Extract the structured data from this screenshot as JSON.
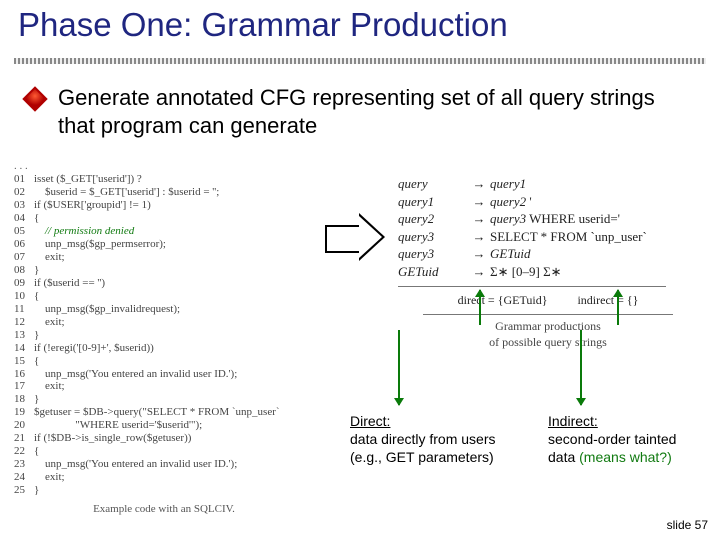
{
  "title": "Phase One: Grammar Production",
  "bullet": "Generate annotated CFG representing set of all query strings that program can generate",
  "code": {
    "ellipsis": ". . .",
    "lines": [
      {
        "n": "01",
        "t": "isset ($_GET['userid']) ?"
      },
      {
        "n": "02",
        "t": "    $userid = $_GET['userid'] : $userid = '';"
      },
      {
        "n": "03",
        "t": "if ($USER['groupid'] != 1)"
      },
      {
        "n": "04",
        "t": "{"
      },
      {
        "n": "05",
        "t": "    // permission denied",
        "comment": true
      },
      {
        "n": "06",
        "t": "    unp_msg($gp_permserror);"
      },
      {
        "n": "07",
        "t": "    exit;"
      },
      {
        "n": "08",
        "t": "}"
      },
      {
        "n": "09",
        "t": "if ($userid == '')"
      },
      {
        "n": "10",
        "t": "{"
      },
      {
        "n": "11",
        "t": "    unp_msg($gp_invalidrequest);"
      },
      {
        "n": "12",
        "t": "    exit;"
      },
      {
        "n": "13",
        "t": "}"
      },
      {
        "n": "14",
        "t": "if (!eregi('[0-9]+', $userid))"
      },
      {
        "n": "15",
        "t": "{"
      },
      {
        "n": "16",
        "t": "    unp_msg('You entered an invalid user ID.');"
      },
      {
        "n": "17",
        "t": "    exit;"
      },
      {
        "n": "18",
        "t": "}"
      },
      {
        "n": "19",
        "t": "$getuser = $DB->query(\"SELECT * FROM `unp_user`"
      },
      {
        "n": "20",
        "t": "               \"WHERE userid='$userid'\");"
      },
      {
        "n": "21",
        "t": "if (!$DB->is_single_row($getuser))"
      },
      {
        "n": "22",
        "t": "{"
      },
      {
        "n": "23",
        "t": "    unp_msg('You entered an invalid user ID.');"
      },
      {
        "n": "24",
        "t": "    exit;"
      },
      {
        "n": "25",
        "t": "}"
      }
    ],
    "caption": "Example code with an SQLCIV."
  },
  "grammar": {
    "productions": [
      {
        "lhs": "query",
        "rhs_italic_a": "query1",
        "rhs_rest": ""
      },
      {
        "lhs": "query1",
        "rhs_italic_a": "query2",
        "rhs_rest": "'"
      },
      {
        "lhs": "query2",
        "rhs_italic_a": "query3",
        "rhs_rest": " WHERE userid='"
      },
      {
        "lhs": "query3",
        "rhs_italic_a": "",
        "rhs_rest": "SELECT * FROM `unp_user`"
      },
      {
        "lhs": "query3",
        "rhs_italic_a": "GETuid",
        "rhs_rest": ""
      },
      {
        "lhs": "GETuid",
        "rhs_italic_a": "",
        "rhs_rest": "Σ∗ [0–9] Σ∗"
      }
    ],
    "sets": {
      "direct": "direct = {GETuid}",
      "indirect": "indirect = {}"
    },
    "caption_line1": "Grammar productions",
    "caption_line2": "of possible query strings"
  },
  "annotations": {
    "direct": {
      "label": "Direct:",
      "line1": "data directly from users",
      "line2": "(e.g., GET parameters)"
    },
    "indirect": {
      "label": "Indirect:",
      "line1": "second-order tainted",
      "line2_prefix": "data ",
      "line2_green": "(means what?)"
    }
  },
  "slide_number": "slide 57"
}
